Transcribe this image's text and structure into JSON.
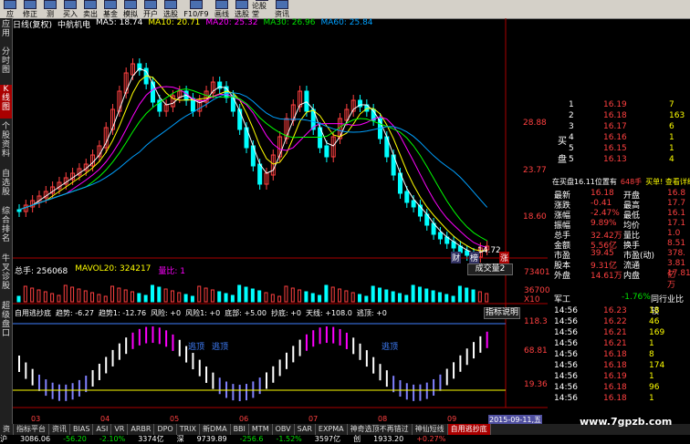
{
  "toolbar": {
    "buttons": [
      {
        "label": "应",
        "icon": "app-icon"
      },
      {
        "label": "修正",
        "icon": "edit-icon"
      },
      {
        "label": "测",
        "icon": "test-icon"
      },
      {
        "label": "买入",
        "icon": "buy-icon"
      },
      {
        "label": "卖出",
        "icon": "sell-icon"
      },
      {
        "label": "基金",
        "icon": "fund-icon"
      },
      {
        "label": "模拟",
        "icon": "simulate-icon"
      },
      {
        "label": "开户",
        "icon": "account-icon"
      },
      {
        "label": "选股",
        "icon": "pick-icon"
      },
      {
        "label": "F10/F9",
        "icon": "f10-icon"
      },
      {
        "label": "画线",
        "icon": "draw-icon"
      },
      {
        "label": "选股",
        "icon": "screener-icon"
      },
      {
        "label": "论股堂",
        "icon": "forum-icon"
      },
      {
        "label": "资讯",
        "icon": "news-icon"
      }
    ]
  },
  "sidebar": {
    "items": [
      {
        "label": "应用"
      },
      {
        "label": "分时图"
      },
      {
        "label": "K线图",
        "active": true
      },
      {
        "label": "个股资料"
      },
      {
        "label": "自选股"
      },
      {
        "label": "综合排名"
      },
      {
        "label": "牛叉诊股"
      },
      {
        "label": "超级盘口"
      }
    ]
  },
  "ma_line": {
    "period": "日线(复权)",
    "stock": "中航机电",
    "ma5": "MA5: 18.74",
    "ma10": "MA10: 20.71",
    "ma20": "MA20: 25.32",
    "ma30": "MA30: 26.96",
    "ma60": "MA60: 25.84"
  },
  "price_axis": [
    "28.88",
    "23.77",
    "18.60"
  ],
  "price_low": "14.72",
  "markers": [
    "财",
    "榜",
    "涨"
  ],
  "volume": {
    "label": "总手: 256068",
    "mavol": "MAVOL20: 324217",
    "ratio": "量比: 1",
    "button": "成交量2",
    "axis": [
      "73401",
      "36700",
      "X10"
    ]
  },
  "indicator": {
    "label": "自用逃抄底",
    "trend": "趋势: -6.27",
    "trend1": "趋势1: -12.76",
    "risk": "风险: +0",
    "risk1": "风险1: +0",
    "bottom": "底部: +5.00",
    "chao": "抄底: +0",
    "tianxian": "天线: +108.0",
    "escape": "逃顶: +0",
    "button": "指标说明",
    "axis": [
      "118.3",
      "68.81",
      "19.36"
    ],
    "tags": [
      "逃顶",
      "逃顶",
      "逃顶"
    ]
  },
  "x_axis": [
    "03",
    "04",
    "05",
    "06",
    "07",
    "08",
    "09"
  ],
  "date_tag": "2015-09-11,五",
  "order_book": {
    "sell": [
      {
        "lvl": "1",
        "price": "16.19",
        "vol": "7"
      },
      {
        "lvl": "2",
        "price": "16.18",
        "vol": "163"
      },
      {
        "lvl": "3",
        "price": "16.17",
        "vol": "6"
      },
      {
        "lvl": "4",
        "price": "16.16",
        "vol": "1"
      },
      {
        "lvl": "5",
        "price": "16.15",
        "vol": "1"
      },
      {
        "lvl": "5",
        "price": "16.13",
        "vol": "4"
      }
    ],
    "side_label_top": "买",
    "side_label_bottom": "盘",
    "hint": "在买盘16.11位置有",
    "hint2": "648手",
    "action": "买单! 查看详细"
  },
  "stats": [
    {
      "k": "最新",
      "v": "16.18",
      "k2": "开盘",
      "v2": "16.8"
    },
    {
      "k": "涨跌",
      "v": "-0.41",
      "k2": "最高",
      "v2": "17.7"
    },
    {
      "k": "涨幅",
      "v": "-2.47%",
      "k2": "最低",
      "v2": "16.1"
    },
    {
      "k": "振幅",
      "v": "9.89%",
      "k2": "均价",
      "v2": "17.1"
    },
    {
      "k": "总手",
      "v": "32.42万",
      "k2": "量比",
      "v2": "1.0"
    },
    {
      "k": "金额",
      "v": "5.56亿",
      "k2": "换手",
      "v2": "8.51"
    },
    {
      "k": "市盈",
      "v": "39.45",
      "k2": "市盈(动)",
      "v2": "378."
    },
    {
      "k": "股本",
      "v": "9.31亿",
      "k2": "流通",
      "v2": "3.81亿"
    },
    {
      "k": "外盘",
      "v": "14.61万",
      "k2": "内盘",
      "v2": "17.81万"
    }
  ],
  "industry": {
    "name": "军工",
    "change": "-1.76%",
    "button": "同行业比较"
  },
  "ticks": [
    {
      "t": "14:56",
      "p": "16.23",
      "v": "18"
    },
    {
      "t": "14:56",
      "p": "16.22",
      "v": "46"
    },
    {
      "t": "14:56",
      "p": "16.21",
      "v": "169"
    },
    {
      "t": "14:56",
      "p": "16.21",
      "v": "1"
    },
    {
      "t": "14:56",
      "p": "16.18",
      "v": "8"
    },
    {
      "t": "14:56",
      "p": "16.18",
      "v": "174"
    },
    {
      "t": "14:56",
      "p": "16.19",
      "v": "1"
    },
    {
      "t": "14:56",
      "p": "16.18",
      "v": "96"
    },
    {
      "t": "14:56",
      "p": "16.18",
      "v": "1"
    }
  ],
  "bottom_tabs": [
    "资",
    "指标平台",
    "资讯",
    "BIAS",
    "ASI",
    "VR",
    "ARBR",
    "DPO",
    "TRIX",
    "新DMA",
    "BBI",
    "MTM",
    "OBV",
    "SAR",
    "EXPMA",
    "神奇选顶不再错过",
    "神仙短线",
    "自用逃抄底"
  ],
  "status": [
    "沪",
    "3086.06",
    "-56.20",
    "-2.10%",
    "3374亿",
    "深",
    "9739.89",
    "-256.6",
    "-1.52%",
    "3597亿",
    "创",
    "1933.20",
    "+0.27%"
  ],
  "watermark": "www.7gpzb.com",
  "colors": {
    "up": "#ff4040",
    "down": "#00ffff",
    "ma5": "#ffffff",
    "ma10": "#ffff00",
    "ma20": "#ff00ff",
    "ma30": "#00ff00",
    "ma60": "#00a0ff"
  }
}
